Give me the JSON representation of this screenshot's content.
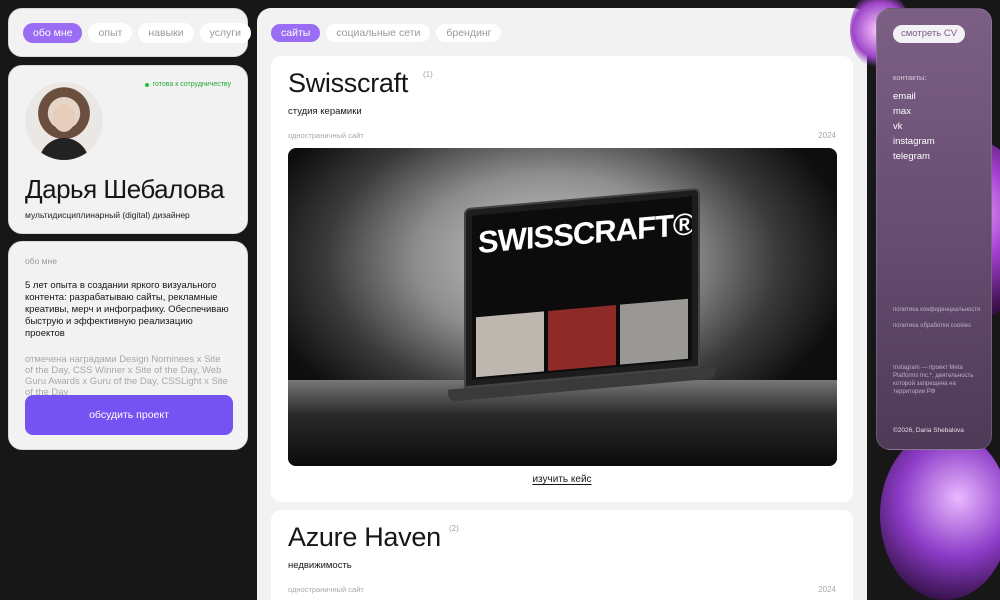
{
  "left_nav": {
    "items": [
      "обо мне",
      "опыт",
      "навыки",
      "услуги"
    ],
    "active_index": 0
  },
  "profile": {
    "status": "готова к сотрудничеству",
    "name": "Дарья Шебалова",
    "role": "мультидисциплинарный (digital) дизайнер"
  },
  "about": {
    "label": "обо мне",
    "text": "5 лет опыта в создании яркого визуального контента: разрабатываю сайты, рекламные креативы, мерч и инфографику. Обеспечиваю быструю и эффективную реализацию проектов",
    "awards": "отмечена наградами Design Nominees x Site of the Day, CSS Winner x Site of the Day, Web Guru Awards x Guru of the Day, CSSLight x Site of the Day",
    "cta": "обсудить проект"
  },
  "center_nav": {
    "items": [
      "сайты",
      "социальные сети",
      "брендинг"
    ],
    "active_index": 0
  },
  "projects": [
    {
      "title": "Swisscraft",
      "number": "(1)",
      "category": "студия керамики",
      "type": "одностраничный сайт",
      "year": "2024",
      "preview_brand": "SWISSCRAFT®",
      "link": "изучить кейс"
    },
    {
      "title": "Azure Haven",
      "number": "(2)",
      "category": "недвижимость",
      "type": "одностраничный сайт",
      "year": "2024"
    }
  ],
  "right": {
    "cv_button": "смотреть CV",
    "contacts_label": "контакты:",
    "contacts": [
      "email",
      "max",
      "vk",
      "instagram",
      "telegram"
    ],
    "policy_1": "политика конфиденциальности",
    "policy_2": "политика обработки cookies",
    "insta_note": "Instagram — проект Meta Platforms Inc.*, деятельность которой запрещена на территории РФ",
    "copyright": "©2026, Daria Shebalova"
  },
  "colors": {
    "accent": "#9b6df4",
    "cta": "#7552f2",
    "status": "#22c238",
    "panel": "#6a4f75"
  }
}
